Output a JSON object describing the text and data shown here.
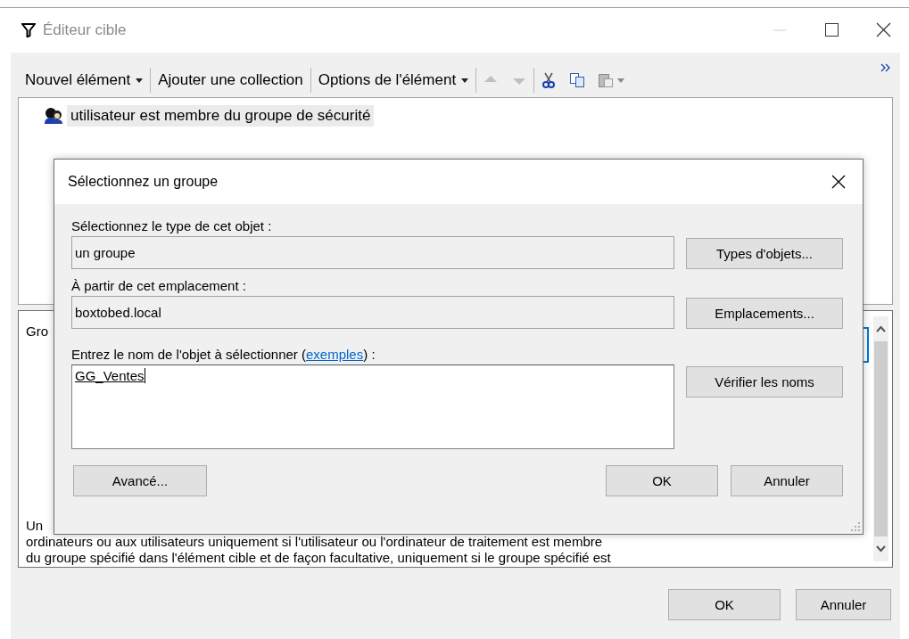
{
  "window": {
    "title": "Éditeur cible"
  },
  "toolbar": {
    "items": [
      {
        "kind": "dropdown",
        "label": "Nouvel élément"
      },
      {
        "kind": "button",
        "label": "Ajouter une collection"
      },
      {
        "kind": "dropdown",
        "label": "Options de l'élément"
      }
    ]
  },
  "tree": {
    "items": [
      {
        "label": "utilisateur est membre du groupe de sécurité",
        "selected": true
      }
    ]
  },
  "description": {
    "heading": "Gro",
    "lines": [
      "Un",
      "ordinateurs ou aux utilisateurs uniquement si l'utilisateur ou l'ordinateur de traitement est membre",
      "du groupe spécifié dans l'élément cible et de façon facultative, uniquement si le groupe spécifié est"
    ]
  },
  "dialog": {
    "title": "Sélectionnez un groupe",
    "type_label": "Sélectionnez le type de cet objet :",
    "type_value": "un groupe",
    "type_button": "Types d'objets...",
    "location_label": "À partir de cet emplacement :",
    "location_value": "boxtobed.local",
    "location_button": "Emplacements...",
    "name_label": {
      "before": "Entrez le nom de l'objet à sélectionner (",
      "link": "exemples",
      "after": ") :"
    },
    "name_value": "GG_Ventes",
    "check_button": "Vérifier les noms",
    "buttons": [
      "Avancé...",
      "OK",
      "Annuler"
    ]
  },
  "buttons": [
    "OK",
    "Annuler"
  ]
}
